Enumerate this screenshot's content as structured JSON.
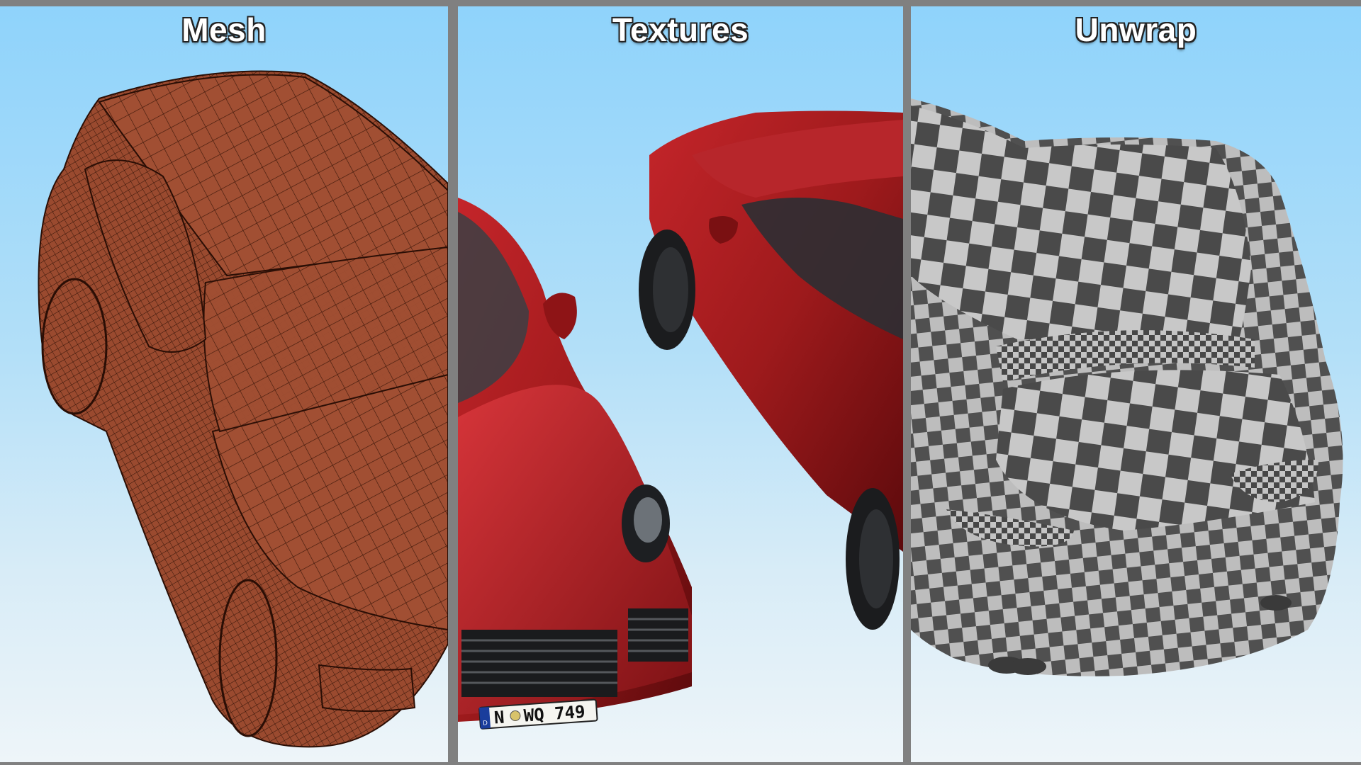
{
  "panels": [
    {
      "title": "Mesh"
    },
    {
      "title": "Textures",
      "license_plate": {
        "country": "D",
        "text": "N",
        "text2": "WQ 749"
      }
    },
    {
      "title": "Unwrap"
    }
  ],
  "colors": {
    "background_top": "#8fd3fb",
    "background_bottom": "#eef5f9",
    "divider": "#808080",
    "mesh_body": "#a14f33",
    "paint_red": "#9e1a1c",
    "checker_dark": "#4a4a4a",
    "checker_light": "#c8c8c8"
  }
}
